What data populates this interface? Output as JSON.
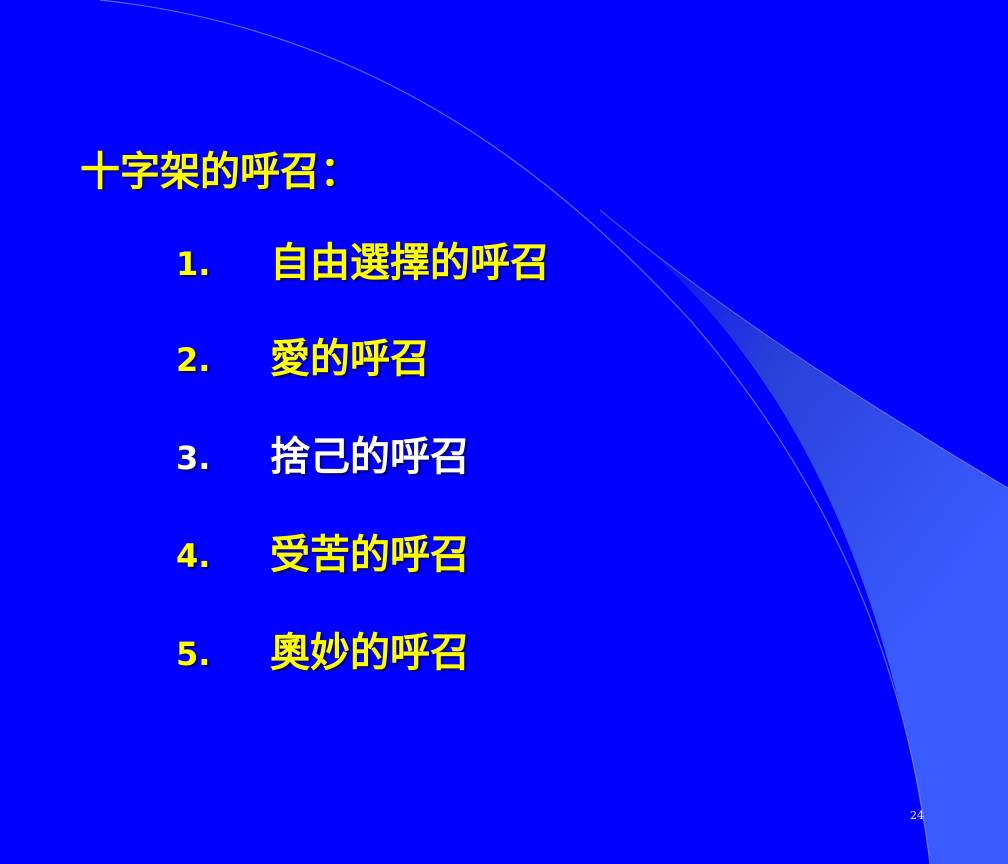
{
  "slide": {
    "title": "十字架的呼召：",
    "items": [
      {
        "number": "1.",
        "text": "自由選擇的呼召",
        "color": "#ffff00"
      },
      {
        "number": "2.",
        "text": "愛的呼召",
        "color": "#ffff00"
      },
      {
        "number": "3.",
        "text": "捨己的呼召",
        "color": "#ffffff"
      },
      {
        "number": "4.",
        "text": "受苦的呼召",
        "color": "#ffff00"
      },
      {
        "number": "5.",
        "text": "奧妙的呼召",
        "color": "#ffff00"
      }
    ],
    "page_number": "24"
  },
  "colors": {
    "background": "#0000ff",
    "title": "#ffff00",
    "accent_band": "#3a5bff"
  }
}
